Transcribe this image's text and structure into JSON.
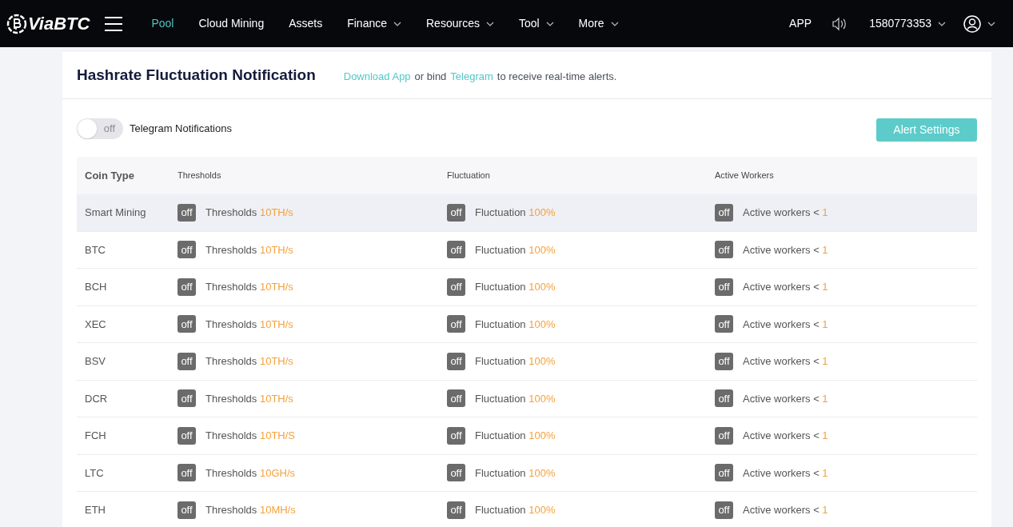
{
  "header": {
    "logo": "ViaBTC",
    "nav": [
      {
        "label": "Pool",
        "selected": true,
        "dropdown": false
      },
      {
        "label": "Cloud Mining",
        "selected": false,
        "dropdown": false
      },
      {
        "label": "Assets",
        "selected": false,
        "dropdown": false
      },
      {
        "label": "Finance",
        "selected": false,
        "dropdown": true
      },
      {
        "label": "Resources",
        "selected": false,
        "dropdown": true
      },
      {
        "label": "Tool",
        "selected": false,
        "dropdown": true
      },
      {
        "label": "More",
        "selected": false,
        "dropdown": true
      }
    ],
    "app": "APP",
    "account": "1580773353"
  },
  "title": "Hashrate Fluctuation Notification",
  "notice": [
    {
      "text": "Download App",
      "link": true
    },
    {
      "text": "or bind",
      "link": false
    },
    {
      "text": "Telegram",
      "link": true
    },
    {
      "text": "to receive real-time alerts.",
      "link": false
    }
  ],
  "telegram": {
    "on": false,
    "state_text": "off",
    "label": "Telegram Notifications"
  },
  "alert_button": "Alert Settings",
  "table": {
    "columns": [
      "Coin Type",
      "Thresholds",
      "Fluctuation",
      "Active Workers"
    ],
    "rows": [
      {
        "coin_type": "Smart Mining",
        "selected": true,
        "thresholds": {
          "on": false,
          "state_text": "off",
          "label": "Thresholds",
          "value": "10TH/s"
        },
        "fluctuation": {
          "on": false,
          "state_text": "off",
          "label": "Fluctuation",
          "value": "100%"
        },
        "active_workers": {
          "on": false,
          "state_text": "off",
          "label": "Active workers <",
          "value": "1"
        }
      },
      {
        "coin_type": "BTC",
        "selected": false,
        "thresholds": {
          "on": false,
          "state_text": "off",
          "label": "Thresholds",
          "value": "10TH/s"
        },
        "fluctuation": {
          "on": false,
          "state_text": "off",
          "label": "Fluctuation",
          "value": "100%"
        },
        "active_workers": {
          "on": false,
          "state_text": "off",
          "label": "Active workers <",
          "value": "1"
        }
      },
      {
        "coin_type": "BCH",
        "selected": false,
        "thresholds": {
          "on": false,
          "state_text": "off",
          "label": "Thresholds",
          "value": "10TH/s"
        },
        "fluctuation": {
          "on": false,
          "state_text": "off",
          "label": "Fluctuation",
          "value": "100%"
        },
        "active_workers": {
          "on": false,
          "state_text": "off",
          "label": "Active workers <",
          "value": "1"
        }
      },
      {
        "coin_type": "XEC",
        "selected": false,
        "thresholds": {
          "on": false,
          "state_text": "off",
          "label": "Thresholds",
          "value": "10TH/s"
        },
        "fluctuation": {
          "on": false,
          "state_text": "off",
          "label": "Fluctuation",
          "value": "100%"
        },
        "active_workers": {
          "on": false,
          "state_text": "off",
          "label": "Active workers <",
          "value": "1"
        }
      },
      {
        "coin_type": "BSV",
        "selected": false,
        "thresholds": {
          "on": false,
          "state_text": "off",
          "label": "Thresholds",
          "value": "10TH/s"
        },
        "fluctuation": {
          "on": false,
          "state_text": "off",
          "label": "Fluctuation",
          "value": "100%"
        },
        "active_workers": {
          "on": false,
          "state_text": "off",
          "label": "Active workers <",
          "value": "1"
        }
      },
      {
        "coin_type": "DCR",
        "selected": false,
        "thresholds": {
          "on": false,
          "state_text": "off",
          "label": "Thresholds",
          "value": "10TH/s"
        },
        "fluctuation": {
          "on": false,
          "state_text": "off",
          "label": "Fluctuation",
          "value": "100%"
        },
        "active_workers": {
          "on": false,
          "state_text": "off",
          "label": "Active workers <",
          "value": "1"
        }
      },
      {
        "coin_type": "FCH",
        "selected": false,
        "thresholds": {
          "on": false,
          "state_text": "off",
          "label": "Thresholds",
          "value": "10TH/S"
        },
        "fluctuation": {
          "on": false,
          "state_text": "off",
          "label": "Fluctuation",
          "value": "100%"
        },
        "active_workers": {
          "on": false,
          "state_text": "off",
          "label": "Active workers <",
          "value": "1"
        }
      },
      {
        "coin_type": "LTC",
        "selected": false,
        "thresholds": {
          "on": false,
          "state_text": "off",
          "label": "Thresholds",
          "value": "10GH/s"
        },
        "fluctuation": {
          "on": false,
          "state_text": "off",
          "label": "Fluctuation",
          "value": "100%"
        },
        "active_workers": {
          "on": false,
          "state_text": "off",
          "label": "Active workers <",
          "value": "1"
        }
      },
      {
        "coin_type": "ETH",
        "selected": false,
        "thresholds": {
          "on": false,
          "state_text": "off",
          "label": "Thresholds",
          "value": "10MH/s"
        },
        "fluctuation": {
          "on": false,
          "state_text": "off",
          "label": "Fluctuation",
          "value": "100%"
        },
        "active_workers": {
          "on": false,
          "state_text": "off",
          "label": "Active workers <",
          "value": "1"
        }
      }
    ]
  }
}
